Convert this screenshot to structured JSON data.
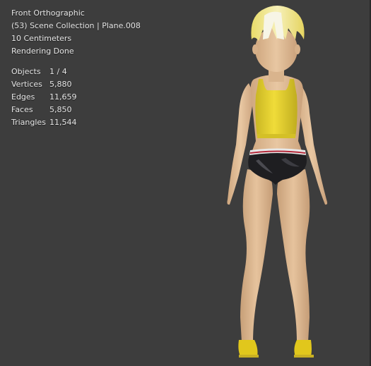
{
  "viewport": {
    "view_name": "Front Orthographic",
    "collection": "(53) Scene Collection | Plane.008",
    "grid_scale": "10 Centimeters",
    "render_status": "Rendering Done"
  },
  "stats": [
    {
      "label": "Objects",
      "value": "1 / 4"
    },
    {
      "label": "Vertices",
      "value": "5,880"
    },
    {
      "label": "Edges",
      "value": "11,659"
    },
    {
      "label": "Faces",
      "value": "5,850"
    },
    {
      "label": "Triangles",
      "value": "11,544"
    }
  ],
  "colors": {
    "background": "#3d3d3d",
    "skin": "#e3bf98",
    "top": "#e6d22d",
    "bottom": "#1e1e20",
    "hair": "#efe48c",
    "shoes": "#e0c61d"
  }
}
